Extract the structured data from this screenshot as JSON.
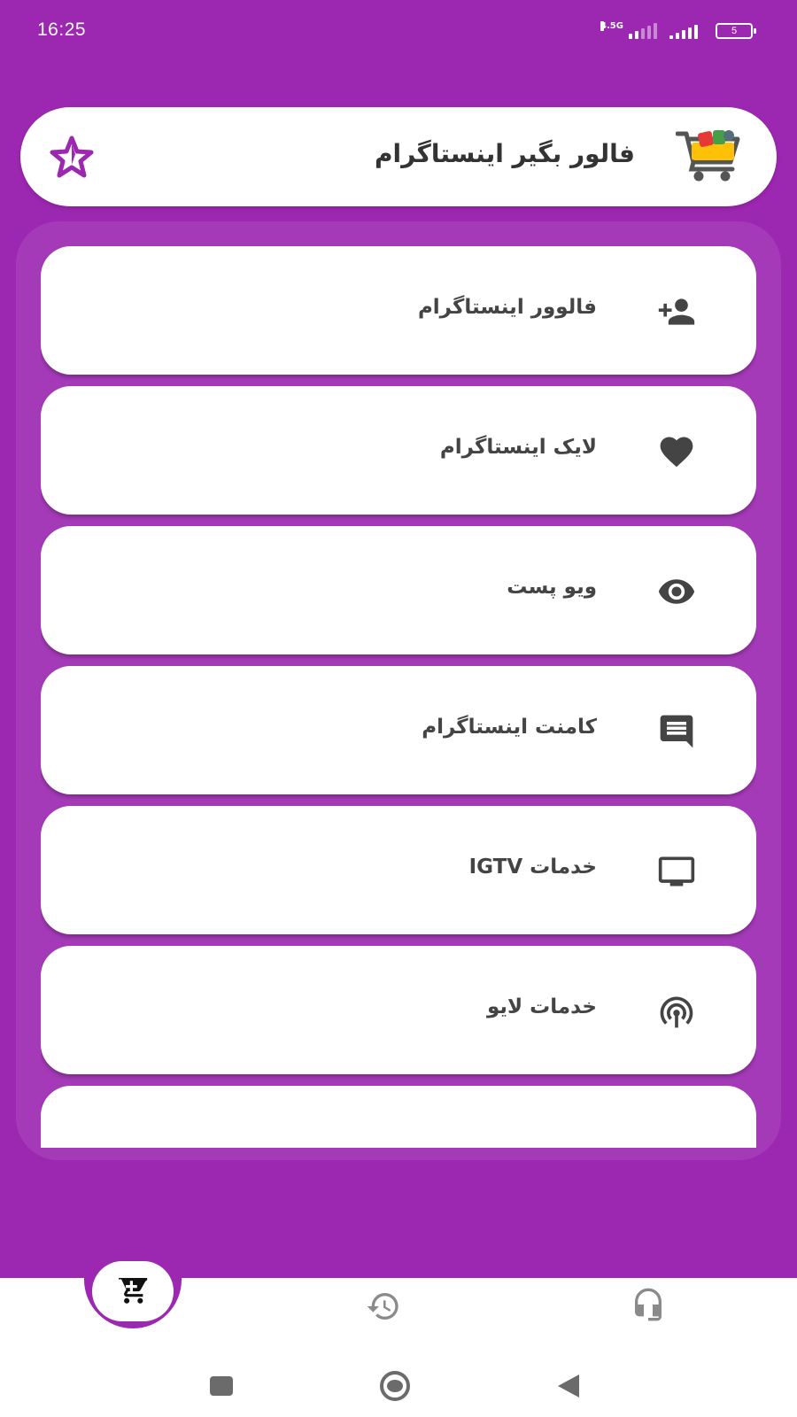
{
  "status_bar": {
    "time": "16:25",
    "network_label": "4.5G",
    "battery_level": "5"
  },
  "header": {
    "title": "فالور بگیر اینستاگرام",
    "logo_icon": "shopping-cart-logo",
    "rate_icon": "star-icon"
  },
  "services": [
    {
      "label": "فالوور اینستاگرام",
      "icon": "add-person-icon"
    },
    {
      "label": "لایک اینستاگرام",
      "icon": "heart-icon"
    },
    {
      "label": "ویو پست",
      "icon": "eye-icon"
    },
    {
      "label": "کامنت اینستاگرام",
      "icon": "comment-icon"
    },
    {
      "label": "خدمات IGTV",
      "icon": "tv-icon"
    },
    {
      "label": "خدمات لایو",
      "icon": "live-icon"
    }
  ],
  "bottom_nav": {
    "items": [
      {
        "name": "shop",
        "icon": "cart-icon",
        "active": true
      },
      {
        "name": "history",
        "icon": "history-icon",
        "active": false
      },
      {
        "name": "support",
        "icon": "headset-icon",
        "active": false
      }
    ]
  },
  "colors": {
    "primary": "#9c27b0",
    "panel": "#a43ab7",
    "card": "#ffffff",
    "icon": "#444444"
  }
}
